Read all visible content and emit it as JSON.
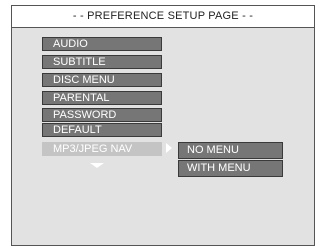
{
  "page": {
    "title": "- - PREFERENCE SETUP PAGE - -"
  },
  "menu": {
    "items": [
      {
        "label": "AUDIO"
      },
      {
        "label": "SUBTITLE"
      },
      {
        "label": "DISC MENU"
      },
      {
        "label": "PARENTAL"
      },
      {
        "label": "PASSWORD"
      },
      {
        "label": "DEFAULT"
      },
      {
        "label": "MP3/JPEG NAV",
        "selected": true
      }
    ],
    "more_below_icon": "chevron-down-icon",
    "open_submenu_icon": "chevron-right-icon"
  },
  "submenu": {
    "options": [
      {
        "label": "NO MENU"
      },
      {
        "label": "WITH MENU"
      }
    ]
  },
  "colors": {
    "panel_background": "#e2e2e2",
    "item_background": "#767676",
    "selected_item_background": "#c4c4c4",
    "item_text": "#ffffff"
  }
}
